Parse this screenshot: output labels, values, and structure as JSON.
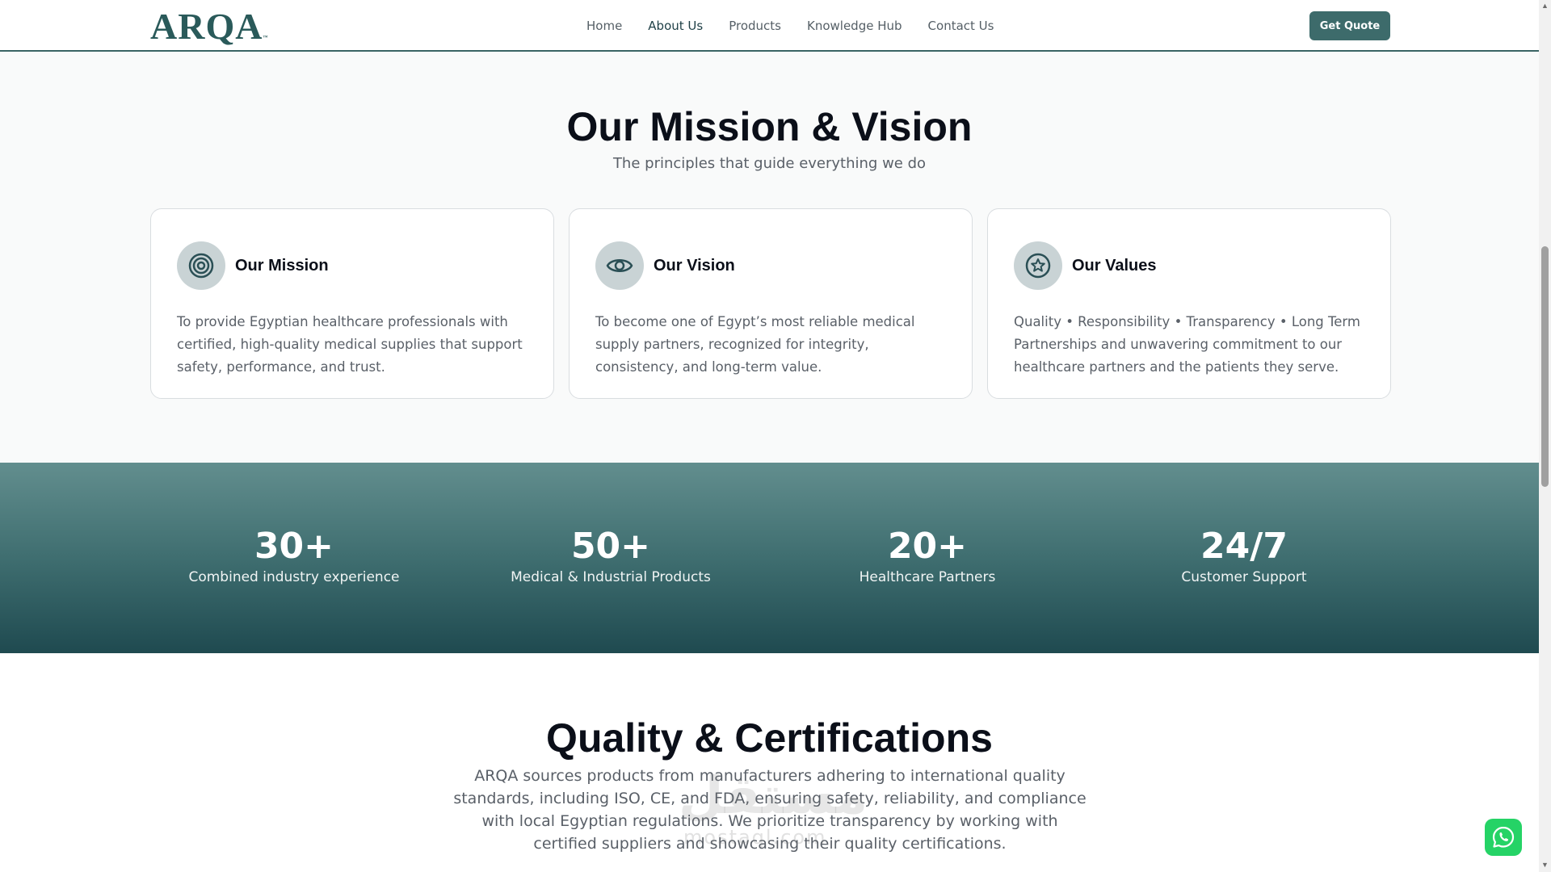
{
  "header": {
    "logo": "ARQA",
    "logo_mark": "™",
    "nav": [
      {
        "label": "Home"
      },
      {
        "label": "About Us"
      },
      {
        "label": "Products"
      },
      {
        "label": "Knowledge Hub"
      },
      {
        "label": "Contact Us"
      }
    ],
    "quote_button": "Get Quote"
  },
  "mission_section": {
    "title": "Our Mission & Vision",
    "subtitle": "The principles that guide everything we do",
    "cards": [
      {
        "icon": "target-icon",
        "title": "Our Mission",
        "text": "To provide Egyptian healthcare professionals with certified, high-quality medical supplies that support safety, performance, and trust."
      },
      {
        "icon": "eye-icon",
        "title": "Our Vision",
        "text": "To become one of Egypt’s most reliable medical supply partners, recognized for integrity, consistency, and long-term value."
      },
      {
        "icon": "star-badge-icon",
        "title": "Our Values",
        "text": "Quality • Responsibility • Transparency • Long Term Partnerships and unwavering commitment to our healthcare partners and the patients they serve."
      }
    ]
  },
  "stats": [
    {
      "number": "30+",
      "label": "Combined industry experience"
    },
    {
      "number": "50+",
      "label": "Medical & Industrial Products"
    },
    {
      "number": "20+",
      "label": "Healthcare Partners"
    },
    {
      "number": "24/7",
      "label": "Customer Support"
    }
  ],
  "quality_section": {
    "title": "Quality & Certifications",
    "text": "ARQA sources products from manufacturers adhering to international quality standards, including ISO, CE, and FDA, ensuring safety, reliability, and compliance with local Egyptian regulations. We prioritize transparency by working with certified suppliers and showcasing their quality certifications."
  },
  "watermark": {
    "arabic": "مستقل",
    "latin": "mostaql.com"
  },
  "colors": {
    "brand": "#2a5a5a",
    "button": "#3d6b6b",
    "stats_top": "#628e8e",
    "stats_bottom": "#1f4a50",
    "whatsapp": "#25d366"
  }
}
